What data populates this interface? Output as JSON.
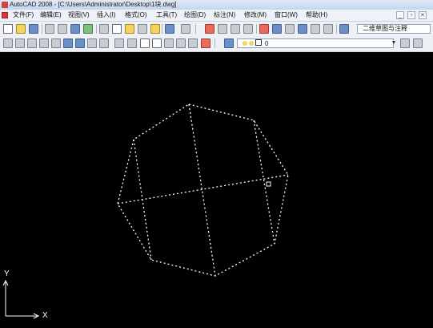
{
  "window": {
    "title": "AutoCAD 2008 - [C:\\Users\\Administrator\\Desktop\\1块.dwg]"
  },
  "menu": {
    "items": [
      "文件(F)",
      "编辑(E)",
      "视图(V)",
      "插入(I)",
      "格式(O)",
      "工具(T)",
      "绘图(D)",
      "标注(N)",
      "修改(M)",
      "窗口(W)",
      "帮助(H)"
    ]
  },
  "toolbar": {
    "workspace_value": "二维草图与注释",
    "layer_value": "0"
  },
  "ucs": {
    "x_label": "X",
    "y_label": "Y"
  },
  "colors": {
    "canvas_background": "#000000",
    "drawing_line": "#ffffff"
  }
}
